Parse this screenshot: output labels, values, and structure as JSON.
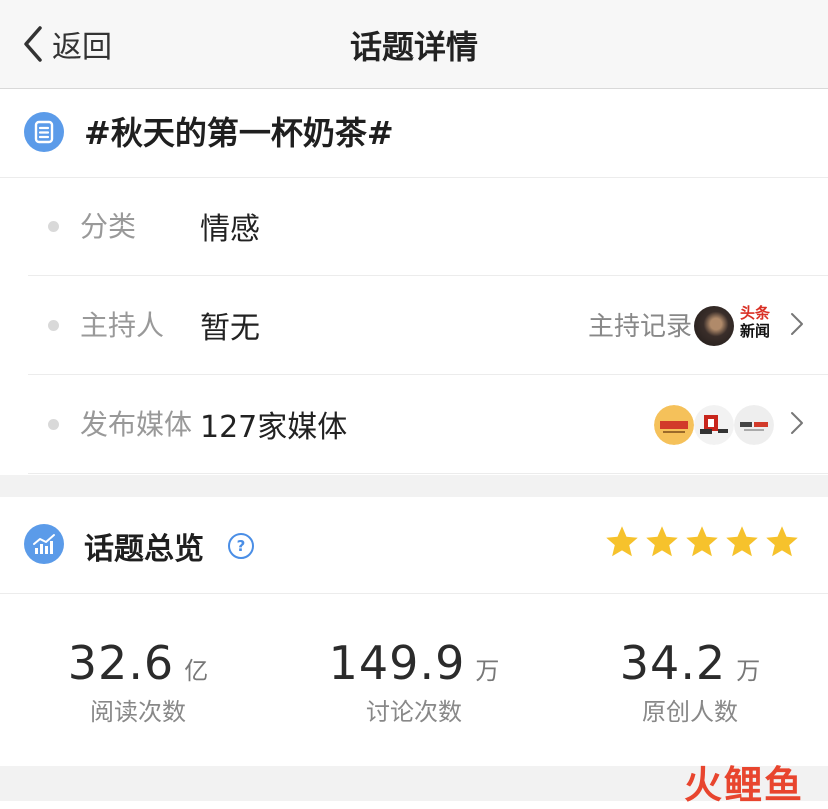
{
  "nav": {
    "back_label": "返回",
    "title": "话题详情"
  },
  "topic": {
    "title": "#秋天的第一杯奶茶#"
  },
  "info": {
    "category": {
      "label": "分类",
      "value": "情感"
    },
    "host": {
      "label": "主持人",
      "value": "暂无",
      "record_label": "主持记录",
      "toutiao_top": "头条",
      "toutiao_bottom": "新闻"
    },
    "media": {
      "label": "发布媒体",
      "value": "127家媒体"
    }
  },
  "overview": {
    "title": "话题总览",
    "help_icon": "question-circle-icon",
    "star_count": 5,
    "stats": [
      {
        "value": "32.6",
        "unit": "亿",
        "label": "阅读次数"
      },
      {
        "value": "149.9",
        "unit": "万",
        "label": "讨论次数"
      },
      {
        "value": "34.2",
        "unit": "万",
        "label": "原创人数"
      }
    ]
  },
  "watermark": {
    "text": "火鲤鱼"
  },
  "colors": {
    "accent": "#4a8ee6",
    "star": "#f6c22c",
    "watermark": "#e8452e"
  }
}
